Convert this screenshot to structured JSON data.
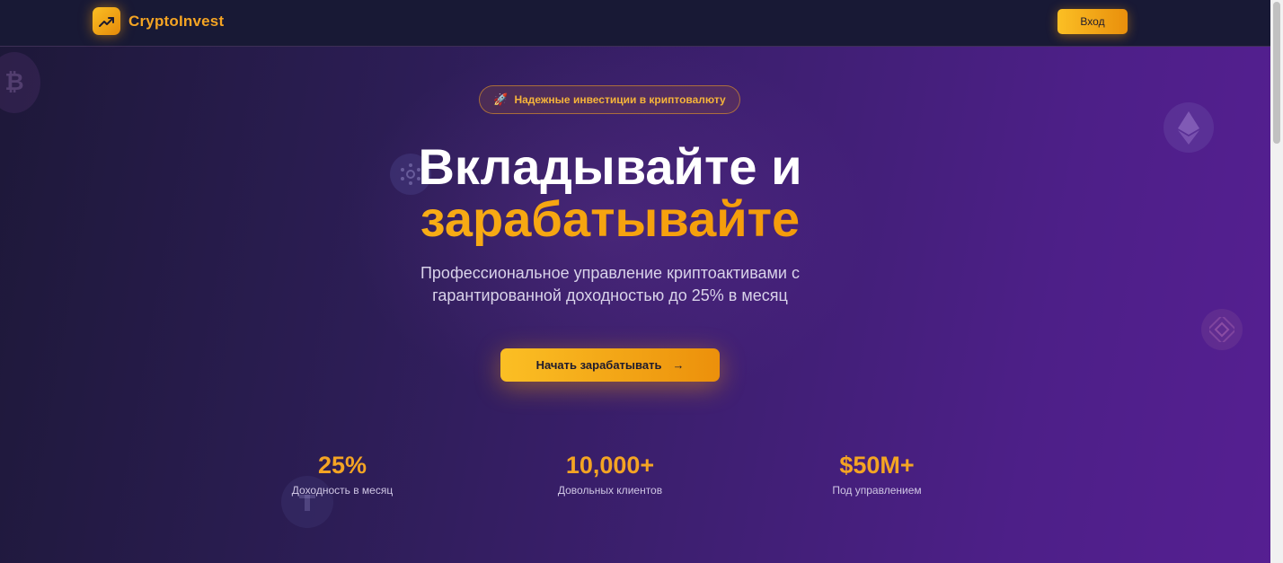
{
  "header": {
    "logo_icon": "trending-up-icon",
    "brand": "CryptoInvest",
    "login_label": "Вход"
  },
  "hero": {
    "badge_icon": "🚀",
    "badge_text": "Надежные инвестиции в криптовалюту",
    "title_line1": "Вкладывайте и",
    "title_line2": "зарабатывайте",
    "subtitle_line1": "Профессиональное управление криптоактивами с",
    "subtitle_line2": "гарантированной доходностью до 25% в месяц",
    "cta_label": "Начать зарабатывать",
    "cta_icon": "→"
  },
  "stats": [
    {
      "value": "25%",
      "label": "Доходность в месяц"
    },
    {
      "value": "10,000+",
      "label": "Довольных клиентов"
    },
    {
      "value": "$50M+",
      "label": "Под управлением"
    }
  ],
  "decorations": {
    "coins": [
      "bitcoin-icon",
      "ethereum-icon",
      "cardano-icon",
      "binance-icon",
      "tether-icon"
    ]
  },
  "colors": {
    "accent": "#f4a423",
    "accent_light": "#fbbf24",
    "accent_dark": "#ea8a0c",
    "header_bg": "#181935",
    "bg_left": "#1d1838",
    "bg_right": "#561f92"
  }
}
